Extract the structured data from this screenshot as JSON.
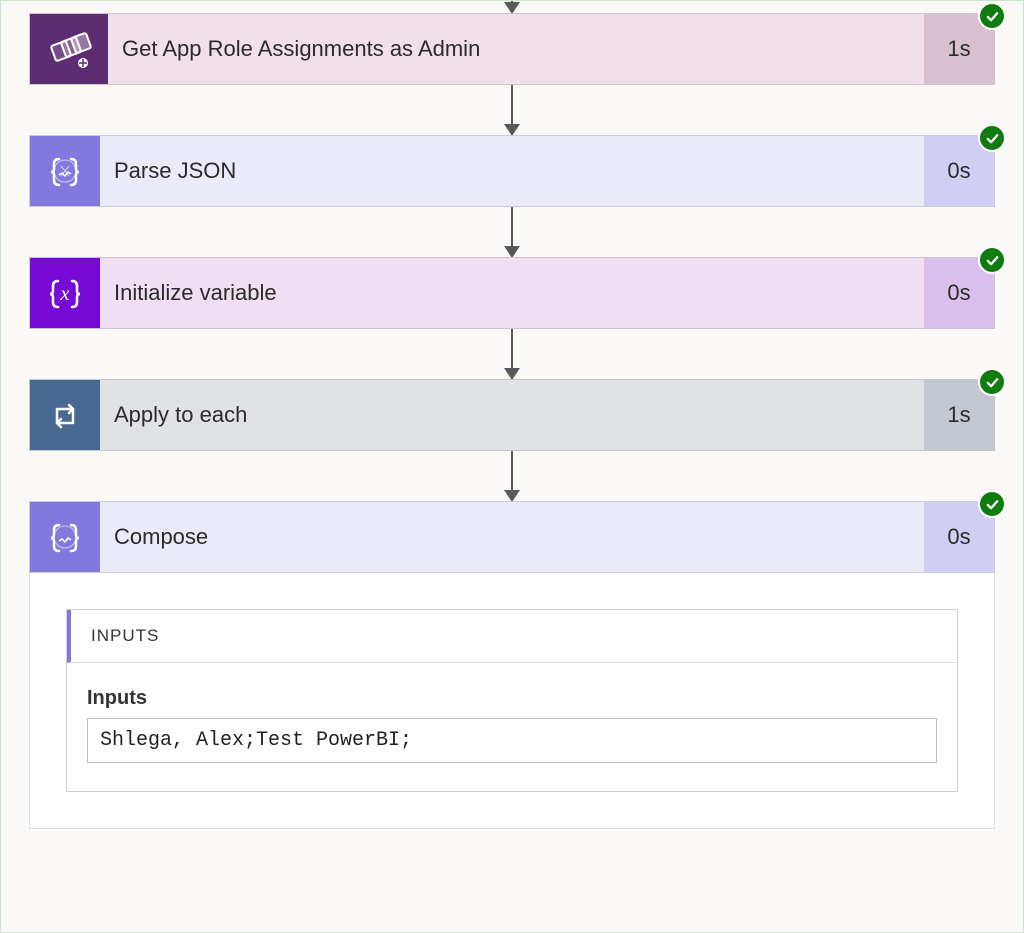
{
  "steps": [
    {
      "id": "get-app-role",
      "label": "Get App Role Assignments as Admin",
      "duration": "1s",
      "status": "success",
      "icon": "dataverse-icon",
      "theme": "admin"
    },
    {
      "id": "parse-json",
      "label": "Parse JSON",
      "duration": "0s",
      "status": "success",
      "icon": "braces-icon",
      "theme": "json"
    },
    {
      "id": "init-variable",
      "label": "Initialize variable",
      "duration": "0s",
      "status": "success",
      "icon": "variable-icon",
      "theme": "init"
    },
    {
      "id": "apply-to-each",
      "label": "Apply to each",
      "duration": "1s",
      "status": "success",
      "icon": "loop-icon",
      "theme": "each"
    },
    {
      "id": "compose",
      "label": "Compose",
      "duration": "0s",
      "status": "success",
      "icon": "braces-icon",
      "theme": "compose"
    }
  ],
  "compose_detail": {
    "section_header": "INPUTS",
    "field_label": "Inputs",
    "field_value": "Shlega, Alex;Test PowerBI;"
  }
}
